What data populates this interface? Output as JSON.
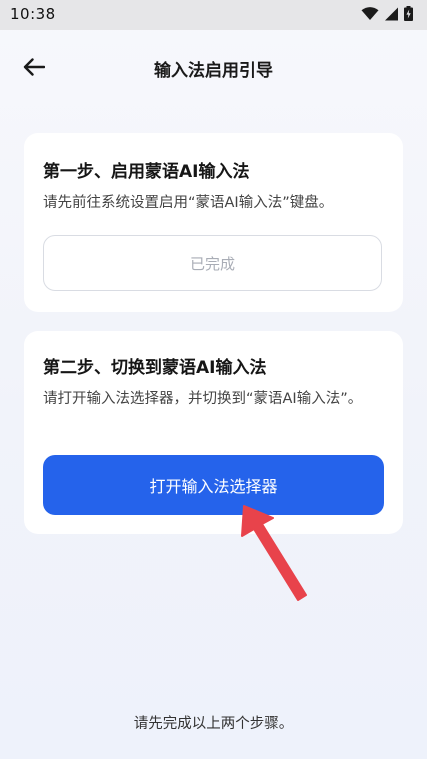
{
  "status_bar": {
    "time": "10:38",
    "icons": [
      "wifi-icon",
      "cellular-signal-icon",
      "battery-charging-icon"
    ]
  },
  "header": {
    "back_icon": "back-arrow-icon",
    "title": "输入法启用引导"
  },
  "step1": {
    "title": "第一步、启用蒙语AI输入法",
    "description": "请先前往系统设置启用“蒙语AI输入法”键盘。",
    "button_label": "已完成"
  },
  "step2": {
    "title": "第二步、切换到蒙语AI输入法",
    "description": "请打开输入法选择器，并切换到“蒙语AI输入法”。",
    "button_label": "打开输入法选择器"
  },
  "footer": {
    "hint": "请先完成以上两个步骤。"
  },
  "colors": {
    "primary": "#2563eb",
    "annotation_arrow": "#e8434b"
  }
}
